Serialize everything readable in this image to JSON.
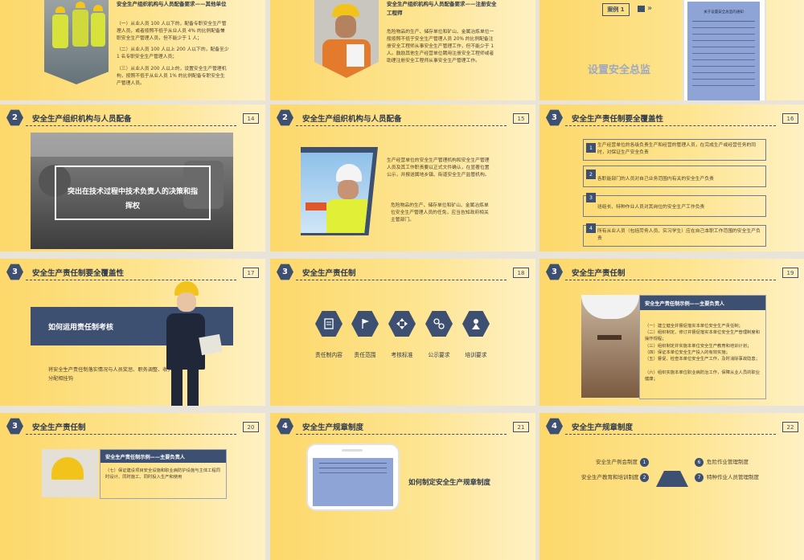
{
  "slides": {
    "s1": {
      "title": "安全生产组织机构与人员配备要求——其他单位",
      "p1": "（一）从业人员 100 人以下的，配备专职安全生产管理人员，或者按照不低于从业人员 4% 的比例配备兼职安全生产管理人员，但不能少于 1 人；",
      "p2": "（二）从业人员 100 人以上 200 人以下的，配备至少 1 名专职安全生产管理人员；",
      "p3": "（三）从业人员 200 人以上的，设置安全生产管理机构，按照不低于从业人员 1% 的比例配备专职安全生产管理人员。"
    },
    "s2": {
      "title": "安全生产组织机构与人员配备要求——注册安全工程师",
      "body": "危险物品的生产、储存单位和矿山、金属冶炼单位一般按照不低于安全生产管理人员 20% 的比例配备注册安全工程师从事安全生产管理工作，但不能少于 1 人。鼓励其他生产经营单位聘用注册安全工程师或者助理注册安全工程师从事安全生产管理工作。"
    },
    "s3": {
      "case_label": "案例 1",
      "heading": "设置安全总监",
      "doc_title": "关于设置安全总监的通知"
    },
    "s4": {
      "num": "2",
      "title": "安全生产组织机构与人员配备",
      "page": "14",
      "box": "突出在技术过程中技术负责人的决策和指挥权"
    },
    "s5": {
      "num": "2",
      "title": "安全生产组织机构与人员配备",
      "page": "15",
      "p1": "生产经营单位的安全生产管理机构和安全生产管理人员及其工作职责要以正式文件确认，在显著位置公示，并报送属地乡镇、街道安全生产监管机构。",
      "p2": "危险物品的生产、储存单位和矿山、金属冶炼单位安全生产管理人员的任免，应当告知政府相关主管部门。"
    },
    "s6": {
      "num": "3",
      "title": "安全生产责任制要全覆盖性",
      "page": "16",
      "items": [
        {
          "n": "1",
          "text": "生产经营单位的各级负责生产和经营的管理人员，在完成生产或经营任务的同时，对保证生产安全负责"
        },
        {
          "n": "2",
          "text": "各职能部门的人员对自己业务范围内有关的安全生产负责"
        },
        {
          "n": "3",
          "text": "班组长、特种作业人员对其岗位的安全生产工作负责"
        },
        {
          "n": "4",
          "text": "所有从业人员（包括劳务人员、实习学生）应在自己本职工作范围的安全生产负责"
        }
      ]
    },
    "s7": {
      "num": "3",
      "title": "安全生产责任制要全覆盖性",
      "page": "17",
      "banner": "如何运用责任制考核",
      "body": "将安全生产责任制落实情况与人员奖惩、职务调整、收入分配相挂钩"
    },
    "s8": {
      "num": "3",
      "title": "安全生产责任制",
      "page": "18",
      "icons": [
        {
          "icon": "document-icon",
          "label": "责任制内容"
        },
        {
          "icon": "flag-icon",
          "label": "责任范围"
        },
        {
          "icon": "arrows-icon",
          "label": "考核标准"
        },
        {
          "icon": "link-icon",
          "label": "公示要求"
        },
        {
          "icon": "training-icon",
          "label": "培训要求"
        }
      ]
    },
    "s9": {
      "num": "3",
      "title": "安全生产责任制",
      "page": "19",
      "card_title": "安全生产责任制示例——主要负责人",
      "lines": [
        "（一）建立健全并督促落实本单位安全生产责任制；",
        "（二）组织制定、修订并督促落实本单位安全生产管理制度和操作规程；",
        "（三）组织制定并实施本单位安全生产教育和培训计划；",
        "（四）保证本单位安全生产投入的有效实施；",
        "（五）督促、检查本单位安全生产工作，及时消除事故隐患；",
        "（六）组织实施本单位职业病防治工作，保障从业人员的职业健康；"
      ]
    },
    "s10": {
      "num": "3",
      "title": "安全生产责任制",
      "page": "20",
      "card_title": "安全生产责任制示例——主要负责人",
      "line": "（七）保证建设项目安全设施和职业病防护设施与主体工程同时设计、同时施工、同时投入生产和使用"
    },
    "s11": {
      "num": "4",
      "title": "安全生产规章制度",
      "page": "21",
      "text": "如何制定安全生产规章制度"
    },
    "s12": {
      "num": "4",
      "title": "安全生产规章制度",
      "page": "22",
      "left": [
        {
          "n": "1",
          "text": "安全生产例会制度"
        },
        {
          "n": "2",
          "text": "安全生产教育和培训制度"
        }
      ],
      "right": [
        {
          "n": "6",
          "text": "危险作业管理制度"
        },
        {
          "n": "7",
          "text": "特种作业人员管理制度"
        }
      ]
    }
  },
  "colors": {
    "navy": "#3d5072",
    "yellow": "#fdd86a",
    "cream": "#fff1c4"
  }
}
